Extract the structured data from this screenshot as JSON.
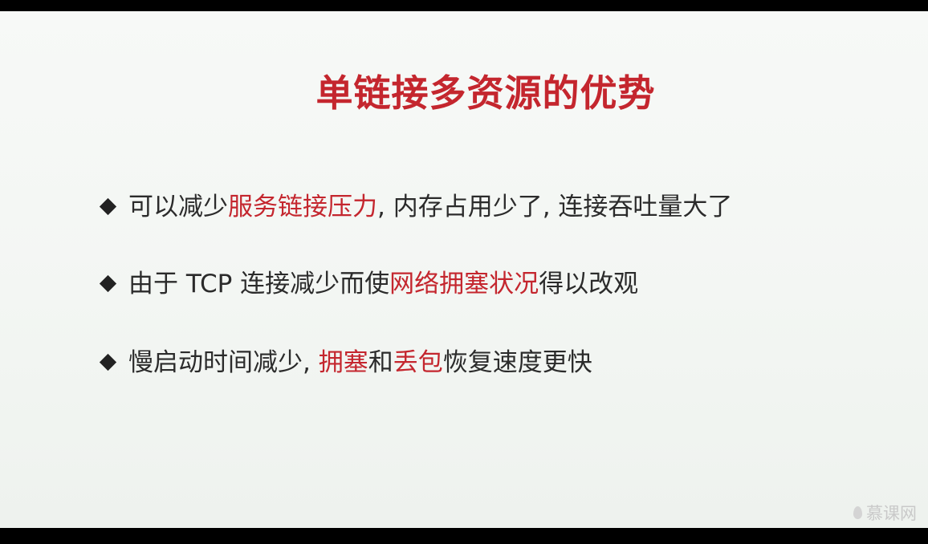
{
  "slide": {
    "title": "单链接多资源的优势",
    "bullets": [
      {
        "parts": [
          {
            "text": "可以减少",
            "highlight": false
          },
          {
            "text": "服务链接压力",
            "highlight": true
          },
          {
            "text": ", 内存占用少了, 连接吞吐量大了",
            "highlight": false
          }
        ]
      },
      {
        "parts": [
          {
            "text": "由于 TCP 连接减少而使",
            "highlight": false
          },
          {
            "text": "网络拥塞状况",
            "highlight": true
          },
          {
            "text": "得以改观",
            "highlight": false
          }
        ]
      },
      {
        "parts": [
          {
            "text": "慢启动时间减少, ",
            "highlight": false
          },
          {
            "text": "拥塞",
            "highlight": true
          },
          {
            "text": "和",
            "highlight": false
          },
          {
            "text": "丢包",
            "highlight": true
          },
          {
            "text": "恢复速度更快",
            "highlight": false
          }
        ]
      }
    ]
  },
  "watermark": {
    "text": "慕课网",
    "icon": "flame-icon"
  },
  "colors": {
    "accent": "#c4262e",
    "text": "#2b2b2b",
    "background": "#f4f7f4"
  }
}
